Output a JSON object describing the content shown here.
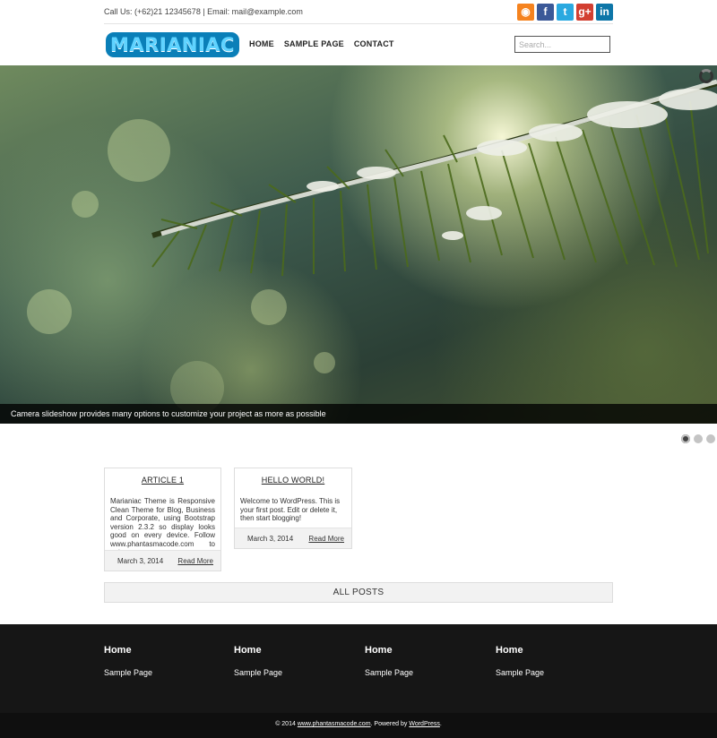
{
  "topbar": {
    "contact": "Call Us: (+62)21 12345678 | Email: mail@example.com",
    "social": [
      {
        "icon": "rss-icon",
        "glyph": "◉"
      },
      {
        "icon": "facebook-icon",
        "glyph": "f"
      },
      {
        "icon": "twitter-icon",
        "glyph": "t"
      },
      {
        "icon": "google-plus-icon",
        "glyph": "g+"
      },
      {
        "icon": "linkedin-icon",
        "glyph": "in"
      }
    ]
  },
  "header": {
    "logo": "MARIANIAC",
    "nav": [
      "HOME",
      "SAMPLE PAGE",
      "CONTACT"
    ],
    "search_placeholder": "Search..."
  },
  "slider": {
    "caption": "Camera slideshow provides many options to customize your project as more as possible",
    "dots": 3,
    "active_dot": 0
  },
  "posts": [
    {
      "title": "ARTICLE 1",
      "excerpt": "Marianiac Theme is Responsive Clean Theme for Blog, Business and Corporate, using Bootstrap version 2.3.2 so display looks good on every device. Follow www.phantasmacode.com to get...",
      "date": "March 3, 2014",
      "more": "Read More"
    },
    {
      "title": "HELLO WORLD!",
      "excerpt": "Welcome to WordPress. This is your first post. Edit or delete it, then start blogging!",
      "date": "March 3, 2014",
      "more": "Read More"
    }
  ],
  "all_posts": "ALL POSTS",
  "footer": {
    "columns": [
      {
        "heading": "Home",
        "link": "Sample Page"
      },
      {
        "heading": "Home",
        "link": "Sample Page"
      },
      {
        "heading": "Home",
        "link": "Sample Page"
      },
      {
        "heading": "Home",
        "link": "Sample Page"
      }
    ],
    "copyright_prefix": "© 2014 ",
    "copyright_site": "www.phantasmacode.com",
    "copyright_mid": ". Powered by ",
    "copyright_wp": "WordPress",
    "copyright_end": "."
  },
  "colors": {
    "rss": "#f5831f",
    "facebook": "#3b5998",
    "twitter": "#2aa9e0",
    "google_plus": "#d23f31",
    "linkedin": "#0e76a8",
    "footer_bg": "#161616"
  }
}
